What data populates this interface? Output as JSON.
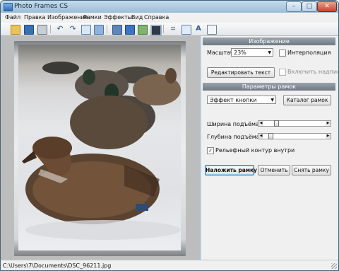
{
  "window": {
    "title": "Photo Frames CS"
  },
  "caption_buttons": {
    "minimize": "–",
    "maximize": "□",
    "close": "✕"
  },
  "menu": [
    "Файл",
    "Правка",
    "Изображение",
    "Рамки",
    "Эффекты",
    "Вид",
    "Справка"
  ],
  "toolbar": {
    "icons": [
      "open-folder-icon",
      "save-icon",
      "print-icon",
      "undo-icon",
      "redo-icon",
      "copy-icon",
      "paste-icon",
      "page-icon",
      "fill-rect-icon",
      "image-icon",
      "frame-icon",
      "crop-icon",
      "edit-icon",
      "text-icon",
      "document-icon"
    ]
  },
  "image_panel": {
    "header": "Изображение",
    "scale_label": "Масштаб:",
    "scale_value": "23%",
    "interpolation_label": "Интерполяция",
    "interpolation_checked": false,
    "edit_text_button": "Редактировать текст",
    "enable_caption_label": "Включить надпись",
    "enable_caption_checked": false
  },
  "frame_panel": {
    "header": "Параметры рамок",
    "effect_value": "Эффект кнопки",
    "catalog_button": "Каталог рамок",
    "width_label": "Ширина подъёма",
    "width_value": 0.18,
    "depth_label": "Глубина подъёма",
    "depth_value": 0.08,
    "inner_relief_label": "Рельефный контур внутри",
    "inner_relief_checked": true
  },
  "actions": {
    "apply": "Наложить рамку",
    "cancel": "Отменить",
    "remove": "Снять рамку"
  },
  "status": {
    "path": "C:\\Users\\7\\Documents\\DSC_96211.jpg"
  },
  "colors": {
    "title_bar": "#b4cfe2",
    "panel": "#f0f0f0",
    "section_header": "#7a838d",
    "canvas_bg": "#bdbdbd"
  }
}
